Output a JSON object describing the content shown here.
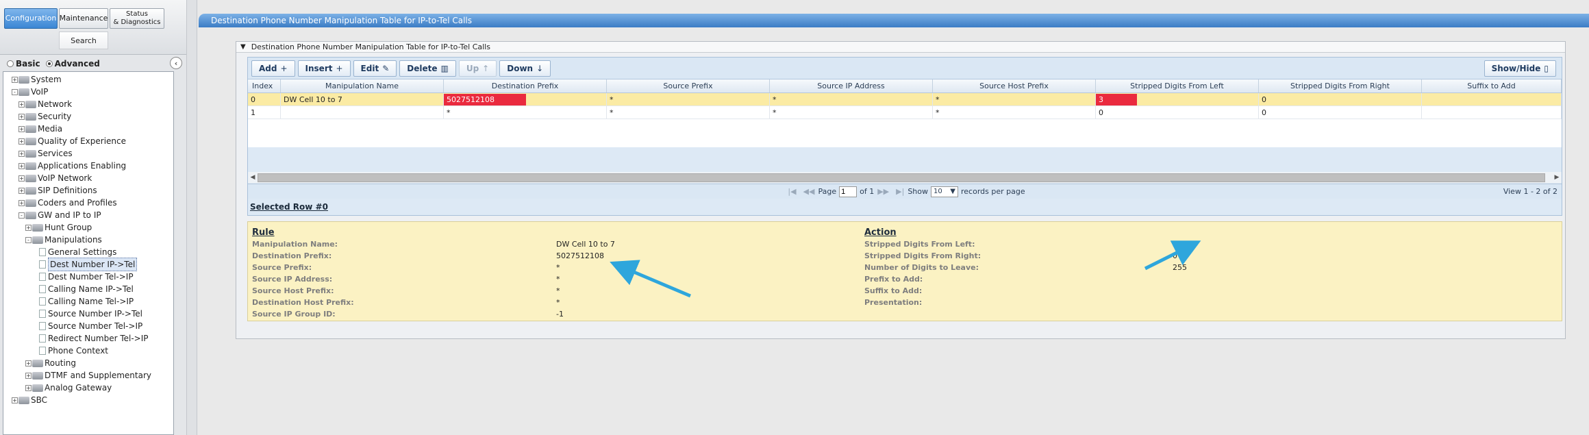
{
  "topnav": {
    "configuration": "Configuration",
    "maintenance": "Maintenance",
    "status_line1": "Status",
    "status_line2": "& Diagnostics",
    "search": "Search"
  },
  "mode": {
    "basic": "Basic",
    "advanced": "Advanced",
    "selected": "Advanced"
  },
  "tree": [
    {
      "label": "System",
      "depth": 0,
      "toggle": "+",
      "kind": "folder"
    },
    {
      "label": "VoIP",
      "depth": 0,
      "toggle": "-",
      "kind": "folder"
    },
    {
      "label": "Network",
      "depth": 1,
      "toggle": "+",
      "kind": "folder"
    },
    {
      "label": "Security",
      "depth": 1,
      "toggle": "+",
      "kind": "folder"
    },
    {
      "label": "Media",
      "depth": 1,
      "toggle": "+",
      "kind": "folder"
    },
    {
      "label": "Quality of Experience",
      "depth": 1,
      "toggle": "+",
      "kind": "folder"
    },
    {
      "label": "Services",
      "depth": 1,
      "toggle": "+",
      "kind": "folder"
    },
    {
      "label": "Applications Enabling",
      "depth": 1,
      "toggle": "+",
      "kind": "folder"
    },
    {
      "label": "VoIP Network",
      "depth": 1,
      "toggle": "+",
      "kind": "folder"
    },
    {
      "label": "SIP Definitions",
      "depth": 1,
      "toggle": "+",
      "kind": "folder"
    },
    {
      "label": "Coders and Profiles",
      "depth": 1,
      "toggle": "+",
      "kind": "folder"
    },
    {
      "label": "GW and IP to IP",
      "depth": 1,
      "toggle": "-",
      "kind": "folder"
    },
    {
      "label": "Hunt Group",
      "depth": 2,
      "toggle": "+",
      "kind": "folder"
    },
    {
      "label": "Manipulations",
      "depth": 2,
      "toggle": "-",
      "kind": "folder"
    },
    {
      "label": "General Settings",
      "depth": 3,
      "toggle": "",
      "kind": "page"
    },
    {
      "label": "Dest Number IP->Tel",
      "depth": 3,
      "toggle": "",
      "kind": "page",
      "selected": true
    },
    {
      "label": "Dest Number Tel->IP",
      "depth": 3,
      "toggle": "",
      "kind": "page"
    },
    {
      "label": "Calling Name IP->Tel",
      "depth": 3,
      "toggle": "",
      "kind": "page"
    },
    {
      "label": "Calling Name Tel->IP",
      "depth": 3,
      "toggle": "",
      "kind": "page"
    },
    {
      "label": "Source Number IP->Tel",
      "depth": 3,
      "toggle": "",
      "kind": "page"
    },
    {
      "label": "Source Number Tel->IP",
      "depth": 3,
      "toggle": "",
      "kind": "page"
    },
    {
      "label": "Redirect Number Tel->IP",
      "depth": 3,
      "toggle": "",
      "kind": "page"
    },
    {
      "label": "Phone Context",
      "depth": 3,
      "toggle": "",
      "kind": "page"
    },
    {
      "label": "Routing",
      "depth": 2,
      "toggle": "+",
      "kind": "folder"
    },
    {
      "label": "DTMF and Supplementary",
      "depth": 2,
      "toggle": "+",
      "kind": "folder"
    },
    {
      "label": "Analog Gateway",
      "depth": 2,
      "toggle": "+",
      "kind": "folder"
    },
    {
      "label": "SBC",
      "depth": 0,
      "toggle": "+",
      "kind": "folder"
    }
  ],
  "page_title": "Destination Phone Number Manipulation Table for IP-to-Tel Calls",
  "panel_title": "Destination Phone Number Manipulation Table for IP-to-Tel Calls",
  "toolbar": {
    "add": "Add",
    "insert": "Insert",
    "edit": "Edit",
    "delete": "Delete",
    "up": "Up",
    "down": "Down",
    "show_hide": "Show/Hide"
  },
  "table": {
    "columns": [
      "Index",
      "Manipulation Name",
      "Destination Prefix",
      "Source Prefix",
      "Source IP Address",
      "Source Host Prefix",
      "Stripped Digits From Left",
      "Stripped Digits From Right",
      "Suffix to Add"
    ],
    "rows": [
      [
        "0",
        "DW Cell 10 to 7",
        "5027512108",
        "*",
        "*",
        "*",
        "3",
        "0",
        ""
      ],
      [
        "1",
        "",
        "*",
        "*",
        "*",
        "*",
        "0",
        "0",
        ""
      ]
    ]
  },
  "pager": {
    "page_label": "Page",
    "page_value": "1",
    "of_label": "of 1",
    "show_label": "Show",
    "show_value": "10",
    "records_label": "records per page",
    "view_info": "View 1 - 2 of 2"
  },
  "selected_row_title": "Selected Row #0",
  "rule": {
    "title": "Rule",
    "fields": [
      {
        "label": "Manipulation Name:",
        "value": "DW Cell 10 to 7"
      },
      {
        "label": "Destination Prefix:",
        "value": "5027512108"
      },
      {
        "label": "Source Prefix:",
        "value": "*"
      },
      {
        "label": "Source IP Address:",
        "value": "*"
      },
      {
        "label": "Source Host Prefix:",
        "value": "*"
      },
      {
        "label": "Destination Host Prefix:",
        "value": "*"
      },
      {
        "label": "Source IP Group ID:",
        "value": "-1"
      }
    ]
  },
  "action": {
    "title": "Action",
    "fields": [
      {
        "label": "Stripped Digits From Left:",
        "value": "3"
      },
      {
        "label": "Stripped Digits From Right:",
        "value": "0"
      },
      {
        "label": "Number of Digits to Leave:",
        "value": "255"
      },
      {
        "label": "Prefix to Add:",
        "value": ""
      },
      {
        "label": "Suffix to Add:",
        "value": ""
      },
      {
        "label": "Presentation:",
        "value": ""
      }
    ]
  },
  "colors": {
    "highlight": "#ea2a3e",
    "selected_row": "#fbeba4",
    "detail_bg": "#fbf2c3",
    "title_bar": "#3b7cc5",
    "annotation_arrow": "#2ea6dc"
  }
}
